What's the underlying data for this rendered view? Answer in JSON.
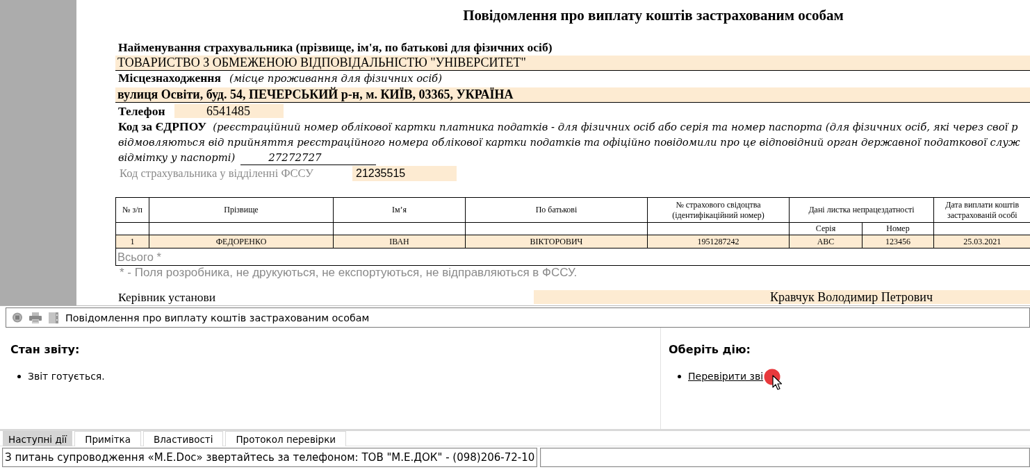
{
  "document": {
    "title": "Повідомлення про виплату коштів застрахованим особам",
    "insurer": {
      "label": "Найменування страхувальника (прізвище, ім'я, по батькові для фізичних осіб)",
      "value": "ТОВАРИСТВО З ОБМЕЖЕНОЮ ВІДПОВІДАЛЬНІСТЮ \"УНІВЕРСИТЕТ\""
    },
    "location": {
      "label": "Місцезнаходження",
      "note": "(місце проживання для фізичних осіб)",
      "value": "вулиця Освіти, буд. 54, ПЕЧЕРСЬКИЙ р-н, м. КИЇВ, 03365, УКРАЇНА"
    },
    "phone": {
      "label": "Телефон",
      "value": "6541485"
    },
    "edrpou": {
      "label": "Код за ЄДРПОУ",
      "note_lines": [
        "(реєстраційний номер облікової картки платника податків - для фізичних осіб або серія та номер паспорта (для фізичних осіб, які через свої р",
        "відмовляються від прийняття реєстраційного номера облікової картки податків та офіційно повідомили про це відповідний орган державної податкової служ",
        "відмітку у паспорті)"
      ],
      "value": "27272727"
    },
    "fssu_code": {
      "label": "Код страхувальника у відділенні ФССУ",
      "value": "21235515"
    },
    "table": {
      "columns": [
        {
          "label": "№ з/п"
        },
        {
          "label": "Прізвище"
        },
        {
          "label": "Ім’я"
        },
        {
          "label": "По батькові"
        },
        {
          "label": "№ страхового свідоцтва (ідентифікаційний номер)"
        },
        {
          "label": "Дані листка непрацездатності",
          "colspan": 2,
          "children": [
            {
              "label": "Серія"
            },
            {
              "label": "Номер"
            }
          ]
        },
        {
          "label": "Дата виплати коштів застрахованій особі"
        }
      ],
      "rows": [
        {
          "cells": [
            "1",
            "ФЕДОРЕНКО",
            "ІВАН",
            "ВІКТОРОВИЧ",
            "1951287242",
            "ABC",
            "123456",
            "25.03.2021"
          ]
        }
      ],
      "total_label": "Всього *"
    },
    "footnote": "* - Поля розробника, не друкуються, не експортуються, не відправляються в ФССУ.",
    "signatory": {
      "label": "Керівник установи",
      "value": "Кравчук Володимир Петрович"
    }
  },
  "toolbar": {
    "title": "Повідомлення про виплату коштів застрахованим особам"
  },
  "status_panel": {
    "heading": "Стан звіту:",
    "items": [
      "Звіт готується."
    ]
  },
  "actions_panel": {
    "heading": "Оберіть дію:",
    "links": [
      "Перевірити зві"
    ]
  },
  "tabs": [
    {
      "label": "Наступні дії",
      "selected": true
    },
    {
      "label": "Примітка",
      "selected": false
    },
    {
      "label": "Властивості",
      "selected": false
    },
    {
      "label": "Протокол перевірки",
      "selected": false
    }
  ],
  "status_bar": {
    "message": "З питань супроводження «M.E.Doc» звертайтесь за телефоном: ТОВ \"М.Е.ДОК\" - (098)206-72-10"
  }
}
